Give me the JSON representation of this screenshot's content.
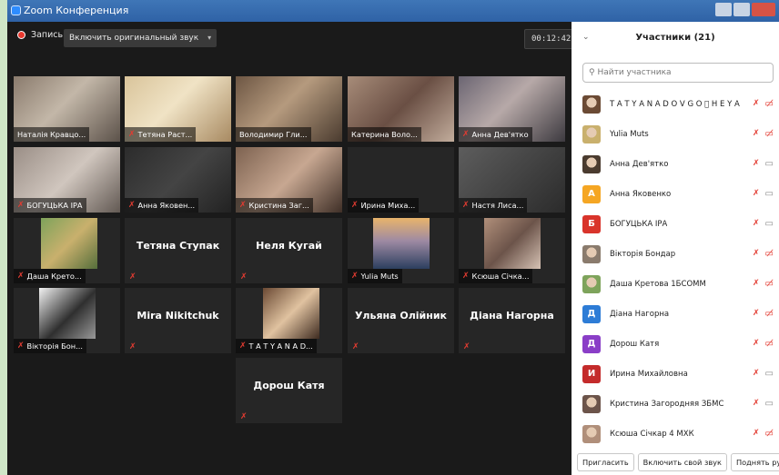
{
  "window": {
    "title": "Zoom Конференция"
  },
  "toolbar": {
    "record_label": "Запись",
    "original_sound_label": "Включить оригинальный звук",
    "original_sound_arrow": "▾",
    "timer": "00:12:42"
  },
  "tiles": [
    {
      "name": "Наталія Кравцо...",
      "mic_off": false
    },
    {
      "name": "Тетяна Раст...",
      "mic_off": true
    },
    {
      "name": "Володимир Гли...",
      "mic_off": false,
      "active": true
    },
    {
      "name": "Катерина Воло...",
      "mic_off": false
    },
    {
      "name": "Анна Дев'ятко",
      "mic_off": true
    },
    {
      "name": "БОГУЦЬКА ІРА",
      "mic_off": true
    },
    {
      "name": "Анна Яковен...",
      "mic_off": true
    },
    {
      "name": "Кристина Заг...",
      "mic_off": true
    },
    {
      "name": "Ирина Миха...",
      "mic_off": true
    },
    {
      "name": "Настя Лиса...",
      "mic_off": true
    },
    {
      "name": "Даша Крето...",
      "mic_off": true
    },
    {
      "big_name": "Тетяна Ступак",
      "mic_off": true
    },
    {
      "big_name": "Неля Кугай",
      "mic_off": true
    },
    {
      "name": "Yulia Muts",
      "mic_off": true
    },
    {
      "name": "Ксюша Січка...",
      "mic_off": true
    },
    {
      "name": "Вікторія Бон...",
      "mic_off": true
    },
    {
      "big_name": "Mira Nikitchuk",
      "mic_off": true
    },
    {
      "name": "T A T Y A N A D...",
      "mic_off": true
    },
    {
      "big_name": "Ульяна Олійник",
      "mic_off": true
    },
    {
      "big_name": "Діана Нагорна",
      "mic_off": true
    },
    {
      "big_name": "Дорош Катя",
      "mic_off": true
    }
  ],
  "participants_panel": {
    "title": "Участники (21)",
    "search_placeholder": "Найти участника",
    "list": [
      {
        "name": "T A T Y A N A D O V G O ⃞ H E Y A",
        "video_off": true
      },
      {
        "name": "Yulia Muts",
        "video_off": true
      },
      {
        "name": "Анна Дев'ятко",
        "video_off": false
      },
      {
        "name": "Анна Яковенко",
        "avatar_letter": "А",
        "avatar_color": "#f5a623",
        "video_off": false
      },
      {
        "name": "БОГУЦЬКА ІРА",
        "avatar_letter": "Б",
        "avatar_color": "#d9342b",
        "video_off": false
      },
      {
        "name": "Вікторія Бондар",
        "video_off": true
      },
      {
        "name": "Даша Кретова 1БСОММ",
        "video_off": true
      },
      {
        "name": "Діана Нагорна",
        "avatar_letter": "Д",
        "avatar_color": "#2d7cd6",
        "video_off": true
      },
      {
        "name": "Дорош Катя",
        "avatar_letter": "Д",
        "avatar_color": "#8a3ec7",
        "video_off": true
      },
      {
        "name": "Ирина Михайловна",
        "avatar_letter": "И",
        "avatar_color": "#c42b2b",
        "video_off": false
      },
      {
        "name": "Кристина Загородняя ЗБМС",
        "video_off": false
      },
      {
        "name": "Ксюша Січкар 4 МХК",
        "video_off": true
      }
    ],
    "footer": {
      "invite": "Пригласить",
      "unmute_self": "Включить свой звук",
      "raise_hand": "Поднять руку"
    }
  },
  "colors": {
    "active_speaker_border": "#b9e08a",
    "muted_red": "#e23b31",
    "panel_bg": "#ffffff",
    "video_bg": "#1a1a1a"
  }
}
